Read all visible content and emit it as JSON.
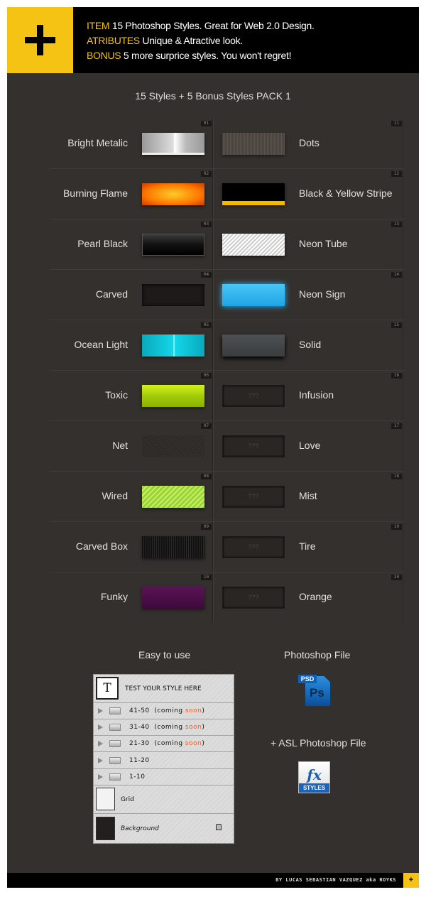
{
  "header": {
    "lines": [
      {
        "key": "ITEM",
        "text": "15 Photoshop Styles. Great for Web 2.0 Design."
      },
      {
        "key": "ATRIBUTES",
        "text": "Unique & Atractive look."
      },
      {
        "key": "BONUS",
        "text": "5 more surprice styles. You won't regret!"
      }
    ],
    "accent": "#f5c314"
  },
  "pack_title": "15 Styles + 5 Bonus Styles PACK 1",
  "styles_left": [
    {
      "num": "01",
      "name": "Bright Metalic",
      "swatch": "s-metal"
    },
    {
      "num": "02",
      "name": "Burning Flame",
      "swatch": "s-flame"
    },
    {
      "num": "03",
      "name": "Pearl Black",
      "swatch": "s-pearl"
    },
    {
      "num": "04",
      "name": "Carved",
      "swatch": "s-carved"
    },
    {
      "num": "05",
      "name": "Ocean Light",
      "swatch": "s-ocean"
    },
    {
      "num": "06",
      "name": "Toxic",
      "swatch": "s-toxic"
    },
    {
      "num": "07",
      "name": "Net",
      "swatch": "s-net"
    },
    {
      "num": "08",
      "name": "Wired",
      "swatch": "s-wired"
    },
    {
      "num": "09",
      "name": "Carved Box",
      "swatch": "s-cbox"
    },
    {
      "num": "10",
      "name": "Funky",
      "swatch": "s-funky"
    }
  ],
  "styles_right": [
    {
      "num": "11",
      "name": "Dots",
      "swatch": "s-dots"
    },
    {
      "num": "12",
      "name": "Black & Yellow Stripe",
      "swatch": "s-stripe"
    },
    {
      "num": "13",
      "name": "Neon Tube",
      "swatch": "s-neon"
    },
    {
      "num": "14",
      "name": "Neon Sign",
      "swatch": "s-sign"
    },
    {
      "num": "15",
      "name": "Solid",
      "swatch": "s-solid"
    },
    {
      "num": "16",
      "name": "Infusion",
      "swatch": "s-unk",
      "mystery": "???"
    },
    {
      "num": "17",
      "name": "Love",
      "swatch": "s-unk",
      "mystery": "???"
    },
    {
      "num": "18",
      "name": "Mist",
      "swatch": "s-unk",
      "mystery": "???"
    },
    {
      "num": "19",
      "name": "Tire",
      "swatch": "s-unk",
      "mystery": "???"
    },
    {
      "num": "20",
      "name": "Orange",
      "swatch": "s-unk",
      "mystery": "???"
    }
  ],
  "easy": {
    "title": "Easy to use",
    "layers": {
      "text_layer": "TEST YOUR STYLE HERE",
      "text_thumb": "T",
      "groups": [
        {
          "range": "41-50",
          "note_pre": "(coming ",
          "note_hl": "soon",
          "note_post": ")"
        },
        {
          "range": "31-40",
          "note_pre": "(coming ",
          "note_hl": "soon",
          "note_post": ")"
        },
        {
          "range": "21-30",
          "note_pre": "(coming ",
          "note_hl": "soon",
          "note_post": ")"
        },
        {
          "range": "11-20"
        },
        {
          "range": "1-10"
        }
      ],
      "grid": "Grid",
      "background": "Background"
    }
  },
  "files": {
    "psd_title": "Photoshop File",
    "psd_icon": "PSD",
    "ps": "Ps",
    "asl_title": "+ ASL Photoshop File",
    "fx": "fx",
    "styles": "STYLES"
  },
  "footer": {
    "credit": "BY LUCAS SEBASTIAN VAZQUEZ aka ROYKS",
    "plus": "+"
  }
}
